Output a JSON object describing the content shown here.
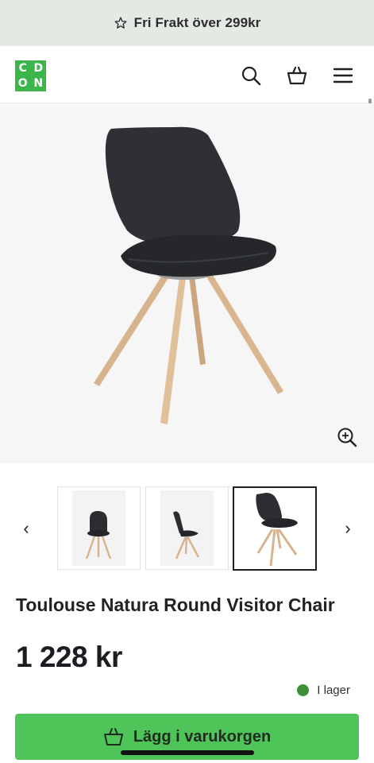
{
  "promo": {
    "text": "Fri Frakt över 299kr",
    "icon": "star-icon"
  },
  "header": {
    "logo_letters": [
      "C",
      "D",
      "O",
      "N"
    ],
    "icons": [
      "search-icon",
      "basket-icon",
      "menu-icon"
    ]
  },
  "gallery": {
    "prev_label": "‹",
    "next_label": "›",
    "thumbnails": [
      "chair-front",
      "chair-side",
      "chair-angle"
    ],
    "selected_index": 2
  },
  "product": {
    "title": "Toulouse Natura Round Visitor Chair",
    "price": "1 228 kr",
    "stock_status": "I lager"
  },
  "cart": {
    "button_label": "Lägg i varukorgen"
  },
  "colors": {
    "brand_green": "#3cb54a",
    "button_green": "#4fc458",
    "stock_green": "#3e8e3a"
  }
}
